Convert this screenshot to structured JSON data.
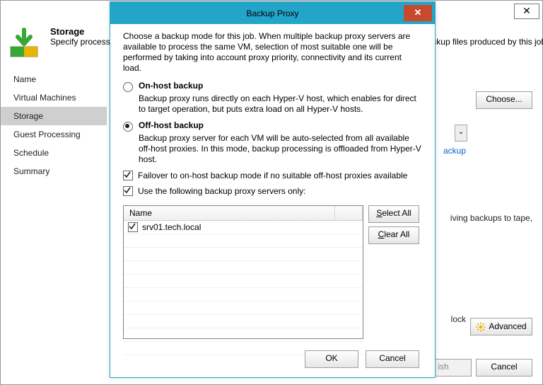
{
  "parent": {
    "title": "Storage",
    "subtitle": "Specify processing proxy server to be used for source data retrieval, backup repository to store the backup files produced by this job and customize advanced job settings if required.",
    "sidebar": [
      "Name",
      "Virtual Machines",
      "Storage",
      "Guest Processing",
      "Schedule",
      "Summary"
    ],
    "choose": "Choose...",
    "linkTail": "ackup",
    "text1": "iving backups to tape,",
    "text2": "lock",
    "advanced": "Advanced",
    "footer": {
      "finish": "ish",
      "cancel": "Cancel"
    }
  },
  "modal": {
    "title": "Backup Proxy",
    "intro": "Choose a backup mode for this job. When multiple backup proxy servers are available to process the same VM, selection of most suitable one will be performed by taking into account proxy priority, connectivity and its current load.",
    "options": [
      {
        "label": "On-host backup",
        "desc": "Backup proxy runs directly on each Hyper-V host, which enables for direct to target operation, but puts extra load on all Hyper-V hosts.",
        "checked": false
      },
      {
        "label": "Off-host backup",
        "desc": "Backup proxy server for each VM will be auto-selected from all available off-host proxies. In this mode, backup processing is offloaded from Hyper-V host.",
        "checked": true
      }
    ],
    "checks": [
      "Failover to on-host backup mode if no suitable off-host proxies available",
      "Use the following backup proxy servers only:"
    ],
    "list": {
      "header": "Name",
      "items": [
        "srv01.tech.local"
      ]
    },
    "selectAll": {
      "u": "S",
      "r": "elect All"
    },
    "clearAll": {
      "u": "C",
      "r": "lear All"
    },
    "ok": "OK",
    "cancel": "Cancel"
  }
}
